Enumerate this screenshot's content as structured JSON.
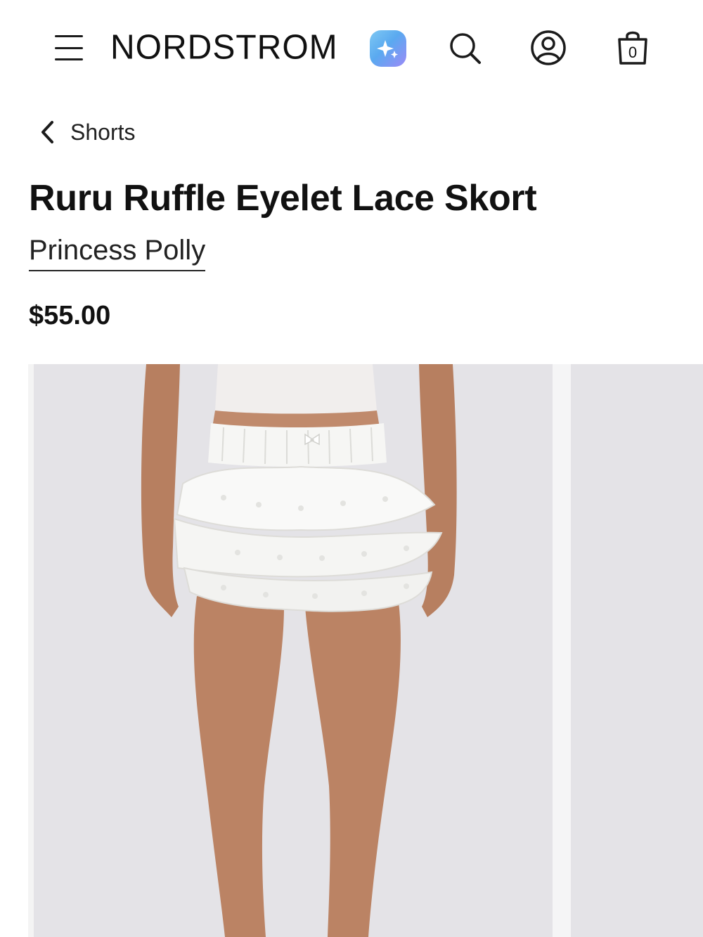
{
  "header": {
    "menu_icon": "hamburger-menu-icon",
    "logo_text": "NORDSTROM",
    "ai_icon": "sparkle-icon",
    "search_icon": "search-icon",
    "account_icon": "account-icon",
    "bag_icon": "shopping-bag-icon",
    "bag_count": "0"
  },
  "breadcrumb": {
    "icon": "chevron-left-icon",
    "label": "Shorts"
  },
  "product": {
    "title": "Ruru Ruffle Eyelet Lace Skort",
    "brand": "Princess Polly",
    "price": "$55.00"
  },
  "gallery": {
    "background_color": "#e4e3e7",
    "slides": [
      {
        "image": "model-wearing-white-ruffle-eyelet-skort"
      },
      {
        "image": "next-product-image"
      }
    ]
  }
}
